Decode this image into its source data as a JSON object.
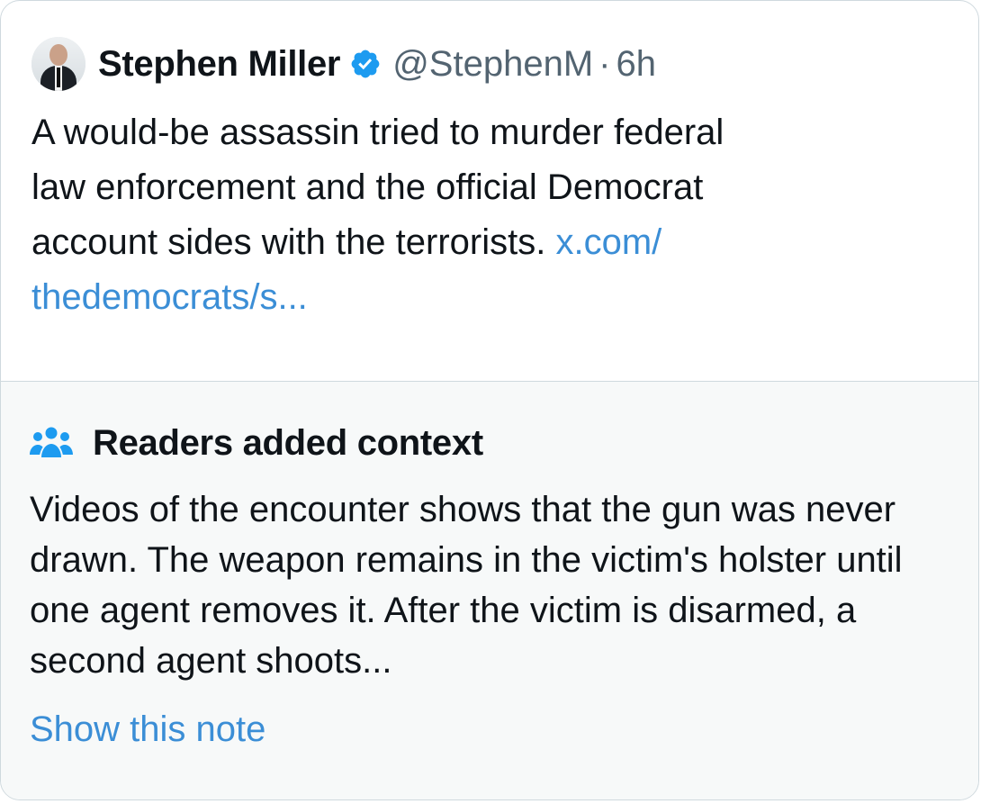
{
  "tweet": {
    "author_name": "Stephen Miller",
    "handle": "@StephenM",
    "separator": "·",
    "time": "6h",
    "text_lines": [
      "A would-be assassin tried to murder federal",
      "law enforcement and the official Democrat",
      "account sides with the terrorists."
    ],
    "link_part1": "x.com/",
    "link_part2": "thedemocrats/s..."
  },
  "note": {
    "title": "Readers added context",
    "body": "Videos of the encounter shows that the gun was never drawn. The weapon remains in the victim's holster until one agent removes it. After the victim is disarmed, a second agent shoots...",
    "show_label": "Show this note"
  },
  "colors": {
    "link": "#3b8ed6",
    "verified": "#1d9bf0",
    "note_bg": "#f7f9f9",
    "secondary_text": "#536471"
  },
  "icons": {
    "verified": "verified-badge-icon",
    "community": "people-icon"
  }
}
